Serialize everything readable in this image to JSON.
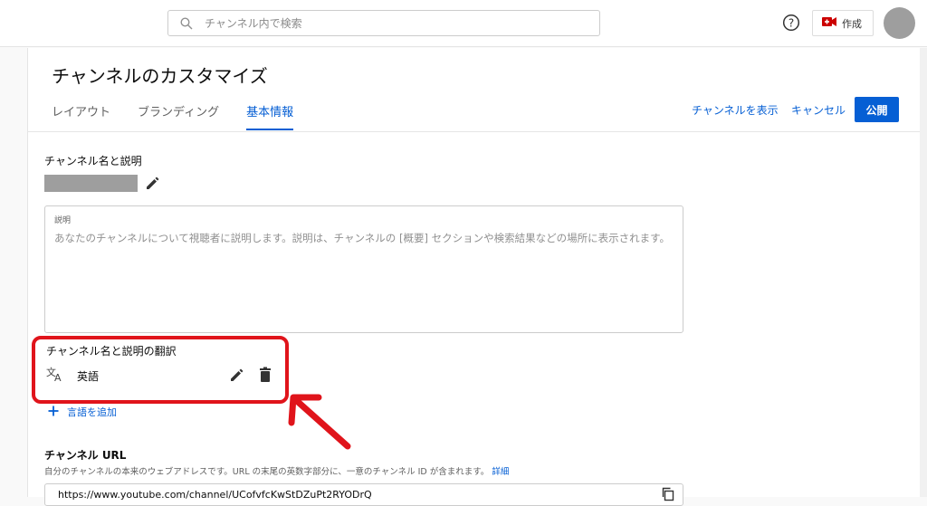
{
  "header": {
    "search_placeholder": "チャンネル内で検索",
    "create_label": "作成"
  },
  "page": {
    "title": "チャンネルのカスタマイズ",
    "tabs": [
      {
        "label": "レイアウト",
        "active": false
      },
      {
        "label": "ブランディング",
        "active": false
      },
      {
        "label": "基本情報",
        "active": true
      }
    ],
    "actions": {
      "view_channel": "チャンネルを表示",
      "cancel": "キャンセル",
      "publish": "公開"
    }
  },
  "basic_info": {
    "name_section_label": "チャンネル名と説明",
    "description": {
      "label": "説明",
      "placeholder": "あなたのチャンネルについて視聴者に説明します。説明は、チャンネルの [概要] セクションや検索結果などの場所に表示されます。"
    },
    "translations": {
      "label": "チャンネル名と説明の翻訳",
      "items": [
        {
          "language": "英語"
        }
      ],
      "add_label": "言語を追加"
    },
    "url": {
      "title": "チャンネル URL",
      "description": "自分のチャンネルの本来のウェブアドレスです。URL の末尾の英数字部分に、一意のチャンネル ID が含まれます。",
      "more_link": "詳細",
      "value": "https://www.youtube.com/channel/UCofvfcKwStDZuPt2RYODrQ"
    }
  },
  "colors": {
    "accent": "#065fd4",
    "highlight": "#e0141b",
    "create_icon": "#cc0000"
  }
}
